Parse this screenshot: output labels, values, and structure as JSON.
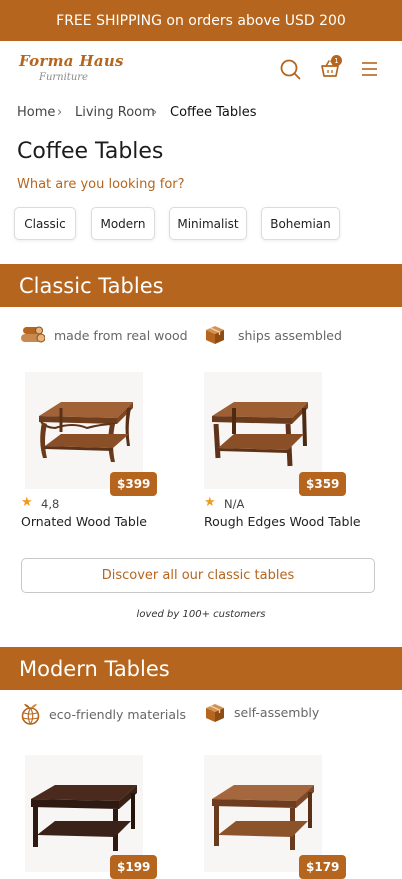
{
  "banner": {
    "text": "FREE SHIPPING on orders above USD 200"
  },
  "brand": {
    "name": "Forma Haus",
    "tagline": "Furniture",
    "color": "#b5651d"
  },
  "header": {
    "icons": [
      "search-icon",
      "basket-icon",
      "menu-icon"
    ],
    "cart_count": "1"
  },
  "breadcrumb": {
    "items": [
      "Home",
      "Living Room",
      "Coffee Tables"
    ]
  },
  "page": {
    "title": "Coffee Tables",
    "subtitle": "What are you looking for?",
    "chips": [
      "Classic",
      "Modern",
      "Minimalist",
      "Bohemian"
    ]
  },
  "classic": {
    "title": "Classic Tables",
    "features": [
      {
        "icon": "wood-logs-icon",
        "label": "made from real wood"
      },
      {
        "icon": "box-icon",
        "label": "ships assembled"
      }
    ],
    "products": [
      {
        "name": "Ornated Wood Table",
        "price": "$399",
        "rating": "4,8"
      },
      {
        "name": "Rough Edges Wood Table",
        "price": "$359",
        "rating": "N/A"
      }
    ],
    "button": "Discover all our classic tables",
    "loved": "loved by 100+ customers"
  },
  "modern": {
    "title": "Modern Tables",
    "features": [
      {
        "icon": "eco-globe-icon",
        "label": "eco-friendly materials"
      },
      {
        "icon": "box-icon",
        "label": "self-assembly"
      }
    ],
    "products": [
      {
        "price": "$199"
      },
      {
        "price": "$179"
      }
    ]
  }
}
